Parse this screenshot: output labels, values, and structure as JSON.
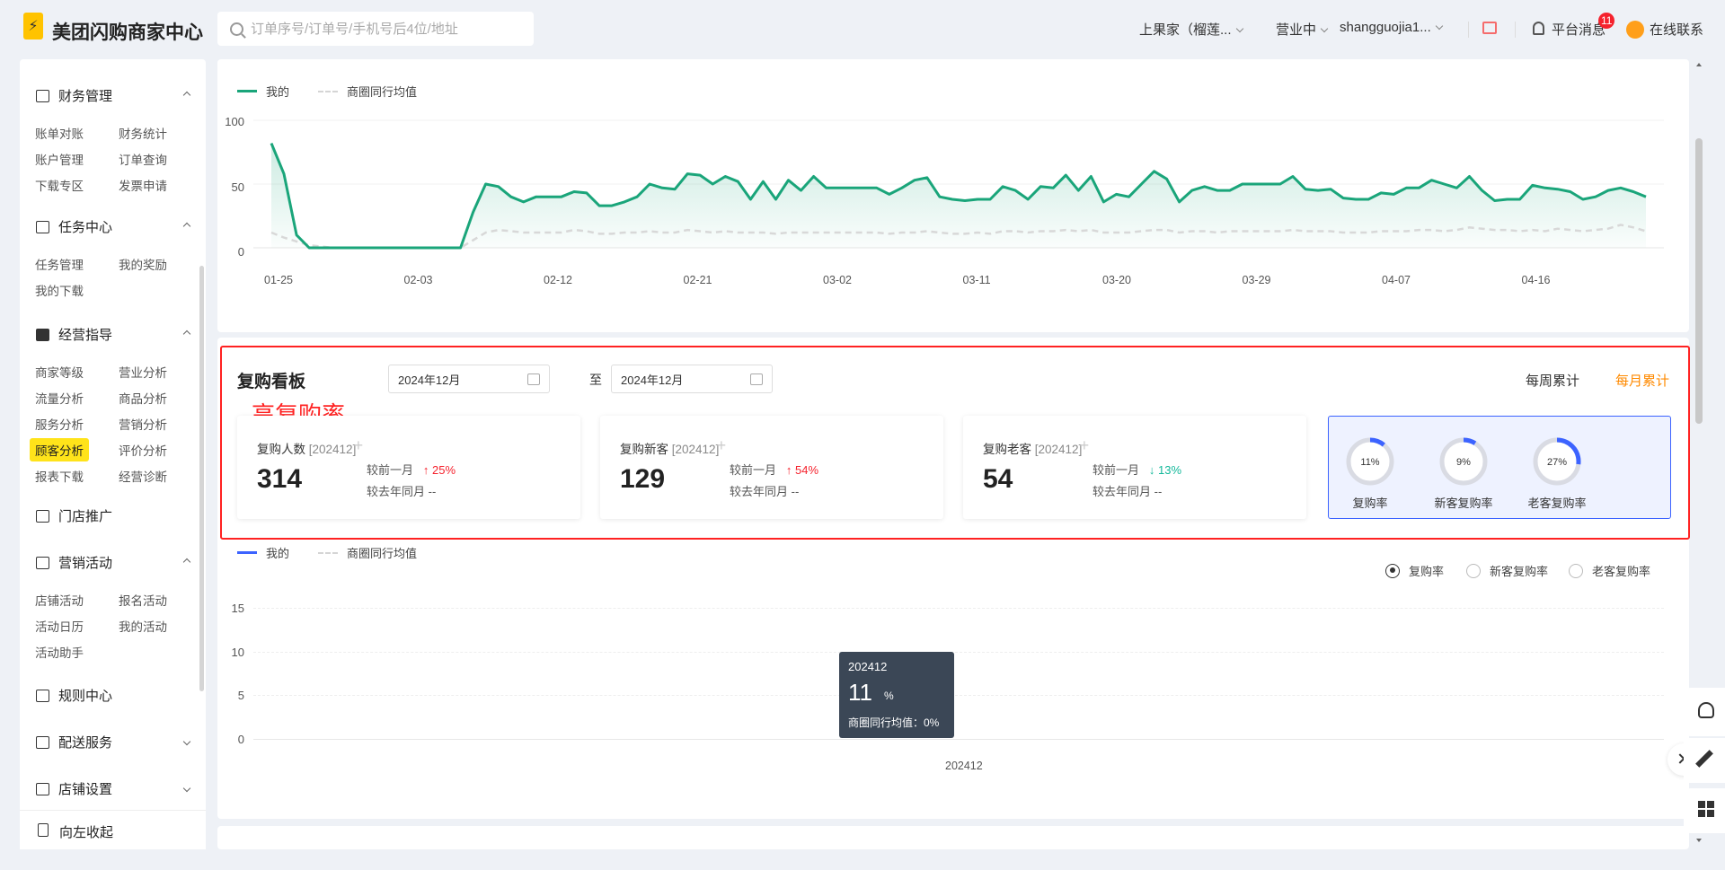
{
  "header": {
    "logo_mark": "⚡",
    "app_title": "美团闪购商家中心",
    "search_placeholder": "订单序号/订单号/手机号后4位/地址",
    "store": "上果家（榴莲...",
    "status": "营业中",
    "account": "shangguojia1...",
    "messages_label": "平台消息",
    "messages_count": "11",
    "contact_label": "在线联系",
    "colors": {
      "brand": "#ffc300",
      "badge": "#f5222d"
    }
  },
  "sidebar": {
    "sections": [
      {
        "title": "财务管理",
        "icon": "wallet-icon",
        "expanded": true,
        "links": [
          "账单对账",
          "财务统计",
          "账户管理",
          "订单查询",
          "下载专区",
          "发票申请"
        ]
      },
      {
        "title": "任务中心",
        "icon": "task-icon",
        "expanded": true,
        "links": [
          "任务管理",
          "我的奖励",
          "我的下载"
        ]
      },
      {
        "title": "经营指导",
        "icon": "chart-icon",
        "expanded": true,
        "links": [
          "商家等级",
          "营业分析",
          "流量分析",
          "商品分析",
          "服务分析",
          "营销分析",
          "顾客分析",
          "评价分析",
          "报表下载",
          "经营诊断"
        ],
        "active": "顾客分析"
      },
      {
        "title": "门店推广",
        "icon": "promote-icon",
        "expanded": false,
        "links": []
      },
      {
        "title": "营销活动",
        "icon": "gift-icon",
        "expanded": true,
        "links": [
          "店铺活动",
          "报名活动",
          "活动日历",
          "我的活动",
          "活动助手"
        ]
      },
      {
        "title": "规则中心",
        "icon": "rule-icon",
        "expanded": false,
        "links": []
      },
      {
        "title": "配送服务",
        "icon": "delivery-icon",
        "expanded": false,
        "links": []
      },
      {
        "title": "店铺设置",
        "icon": "settings-icon",
        "expanded": false,
        "links": []
      }
    ],
    "collapse_label": "向左收起"
  },
  "top_chart": {
    "legend_mine": "我的",
    "legend_avg": "商圈同行均值",
    "y_ticks": [
      "100",
      "50",
      "0"
    ],
    "x_ticks": [
      "01-25",
      "02-03",
      "02-12",
      "02-21",
      "03-02",
      "03-11",
      "03-20",
      "03-29",
      "04-07",
      "04-16"
    ],
    "colors": {
      "mine": "#1aa57a",
      "avg": "#d8d8d8"
    }
  },
  "board": {
    "title": "复购看板",
    "date_from": "2024年12月",
    "to_label": "至",
    "date_to": "2024年12月",
    "weekly": "每周累计",
    "monthly": "每月累计",
    "annotation": "高复购率",
    "cards": [
      {
        "label": "复购人数",
        "period": "[202412]",
        "value": "314",
        "mom_label": "较前一月",
        "mom_arrow": "↑",
        "mom": "25%",
        "yoy_label": "较去年同月",
        "yoy": "--"
      },
      {
        "label": "复购新客",
        "period": "[202412]",
        "value": "129",
        "mom_label": "较前一月",
        "mom_arrow": "↑",
        "mom": "54%",
        "yoy_label": "较去年同月",
        "yoy": "--"
      },
      {
        "label": "复购老客",
        "period": "[202412]",
        "value": "54",
        "mom_label": "较前一月",
        "mom_arrow": "↓",
        "mom": "13%",
        "yoy_label": "较去年同月",
        "yoy": "--"
      }
    ],
    "rings": [
      {
        "label": "复购率",
        "text": "11%",
        "value": 0.11
      },
      {
        "label": "新客复购率",
        "text": "9%",
        "value": 0.09
      },
      {
        "label": "老客复购率",
        "text": "27%",
        "value": 0.27
      }
    ]
  },
  "bottom_chart": {
    "legend_mine": "我的",
    "legend_avg": "商圈同行均值",
    "radios": [
      "复购率",
      "新客复购率",
      "老客复购率"
    ],
    "selected_radio": "复购率",
    "y_ticks": [
      "15",
      "10",
      "5",
      "0"
    ],
    "x_tick": "202412",
    "tooltip_period": "202412",
    "tooltip_value": "11",
    "tooltip_unit": "%",
    "tooltip_avg": "商圈同行均值：0%"
  },
  "chart_data": {
    "type": "line",
    "xlabel": "",
    "ylabel": "",
    "ylim": [
      0,
      100
    ],
    "x": [
      "01-25",
      "02-03",
      "02-12",
      "02-21",
      "03-02",
      "03-11",
      "03-20",
      "03-29",
      "04-07",
      "04-16"
    ],
    "series": [
      {
        "name": "我的",
        "values": [
          82,
          58,
          10,
          0,
          0,
          0,
          0,
          0,
          0,
          0,
          0,
          0,
          0,
          0,
          0,
          0,
          28,
          50,
          48,
          40,
          36,
          40,
          40,
          40,
          44,
          43,
          33,
          33,
          36,
          40,
          50,
          47,
          46,
          58,
          57,
          50,
          56,
          52,
          38,
          52,
          38,
          53,
          45,
          56,
          47,
          47,
          47,
          47,
          47,
          42,
          47,
          53,
          55,
          40,
          38,
          37,
          38,
          38,
          48,
          45,
          38,
          48,
          47,
          57,
          45,
          56,
          36,
          42,
          40,
          50,
          60,
          54,
          36,
          45,
          48,
          45,
          45,
          50,
          50,
          50,
          50,
          56,
          46,
          45,
          46,
          39,
          38,
          38,
          43,
          42,
          47,
          47,
          53,
          50,
          47,
          56,
          45,
          37,
          38,
          38,
          49,
          47,
          46,
          44,
          38,
          40,
          45,
          47,
          44,
          40
        ]
      },
      {
        "name": "商圈同行均值",
        "values": [
          12,
          8,
          5,
          2,
          1,
          0,
          0,
          0,
          0,
          0,
          0,
          0,
          0,
          0,
          0,
          0,
          6,
          12,
          14,
          13,
          12,
          12,
          12,
          12,
          14,
          13,
          11,
          11,
          12,
          12,
          13,
          12,
          12,
          14,
          13,
          12,
          13,
          12,
          12,
          12,
          11,
          12,
          12,
          12,
          12,
          12,
          12,
          12,
          12,
          11,
          12,
          12,
          13,
          12,
          11,
          11,
          12,
          11,
          13,
          13,
          12,
          13,
          13,
          14,
          13,
          14,
          12,
          12,
          12,
          13,
          14,
          14,
          12,
          13,
          13,
          12,
          13,
          13,
          13,
          13,
          13,
          14,
          13,
          13,
          13,
          12,
          12,
          12,
          13,
          13,
          13,
          14,
          14,
          13,
          14,
          16,
          15,
          14,
          14,
          13,
          14,
          13,
          15,
          14,
          13,
          14,
          15,
          18,
          16,
          13
        ]
      }
    ]
  }
}
